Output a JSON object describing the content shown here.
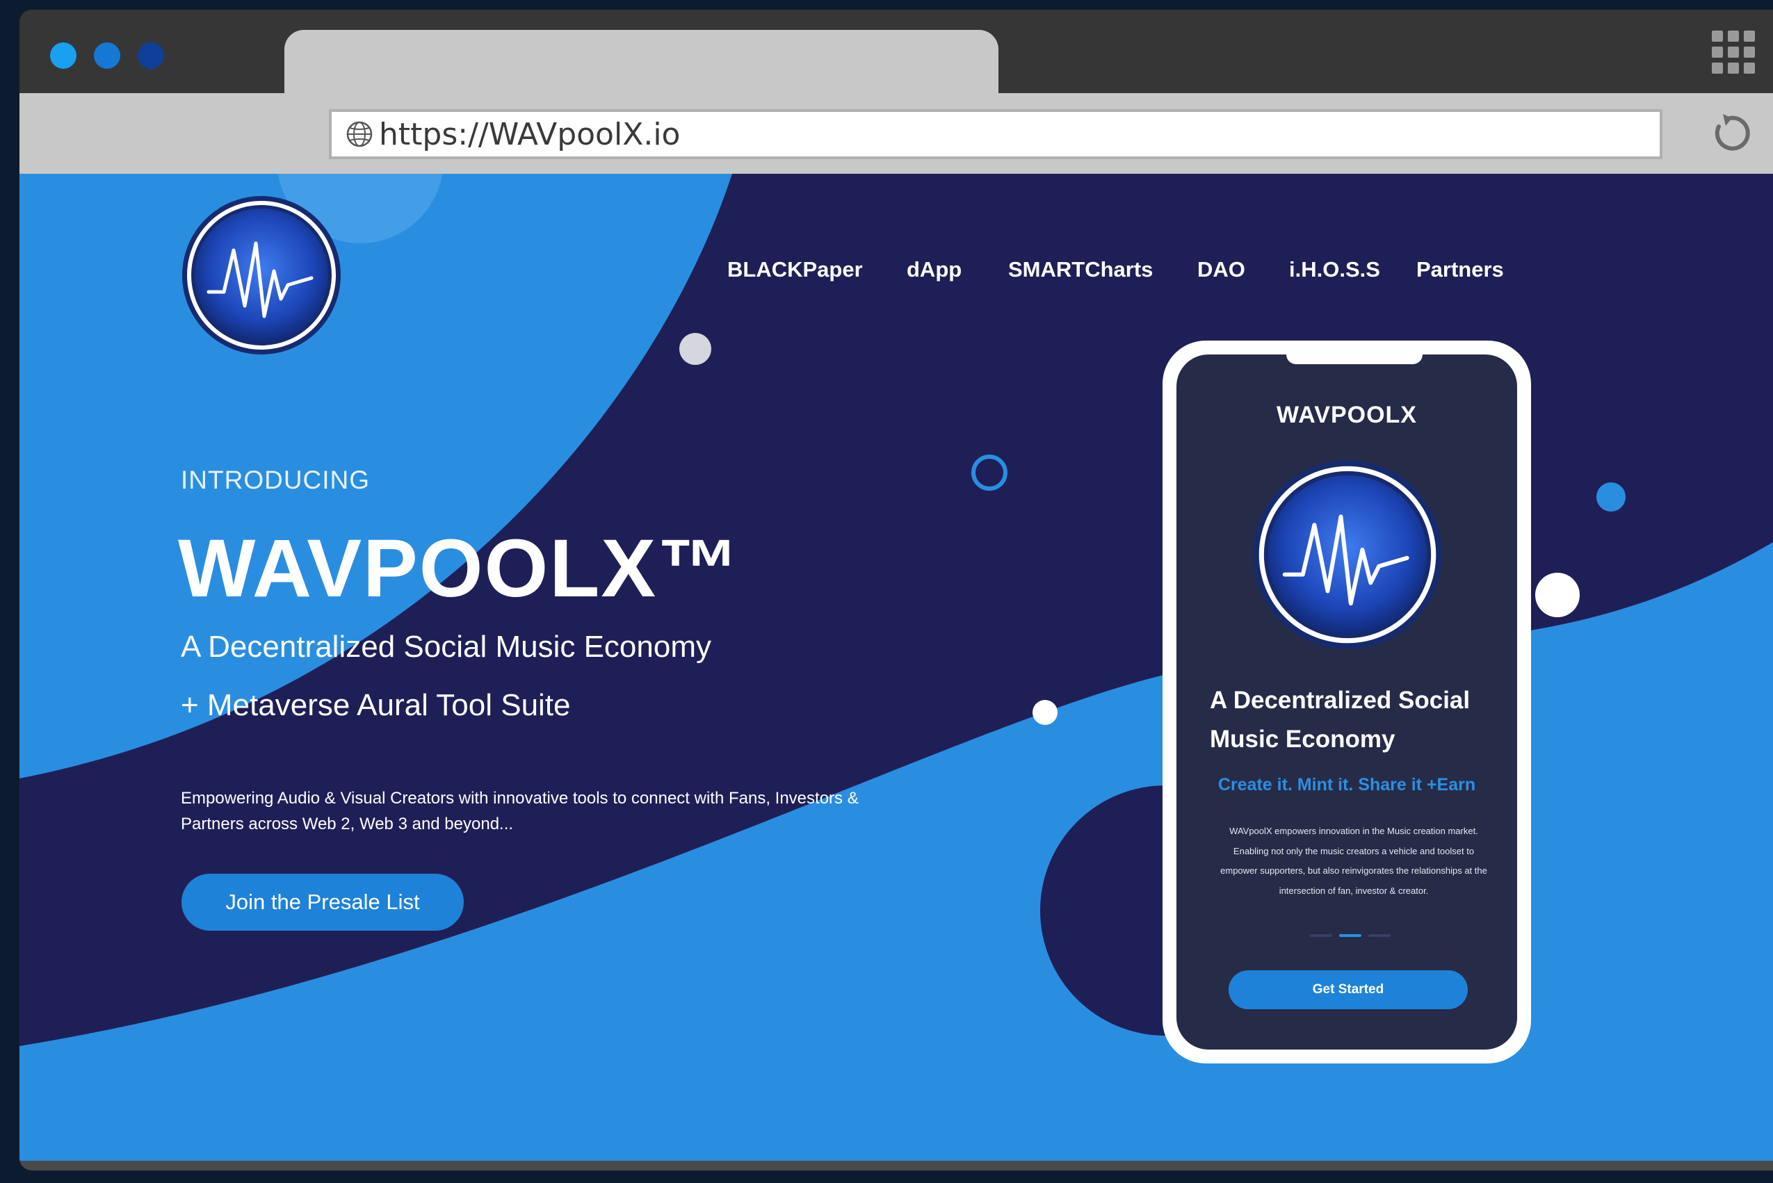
{
  "browser": {
    "url": "https://WAVpoolX.io",
    "traffic_light_colors": [
      "#1aa0f0",
      "#1478d4",
      "#0f3f9a"
    ]
  },
  "site": {
    "nav": [
      "BLACKPaper",
      "dApp",
      "SMARTCharts",
      "DAO",
      "i.H.O.S.S",
      "Partners"
    ],
    "hero": {
      "intro": "INTRODUCING",
      "brand": "WAVPOOLX™",
      "tagline_1": "A Decentralized Social Music Economy",
      "tagline_2": "+ Metaverse Aural Tool Suite",
      "description": "Empowering Audio & Visual Creators with innovative tools to connect with Fans, Investors & Partners across Web 2, Web 3 and beyond...",
      "cta": "Join the Presale List"
    },
    "phone": {
      "brand": "WAVPOOLX",
      "title": "A Decentralized Social Music Economy",
      "subtitle": "Create it. Mint it. Share it +Earn",
      "body": "WAVpoolX empowers innovation in the Music creation market. Enabling not only the music creators a vehicle and toolset to empower supporters, but also reinvigorates the relationships at the intersection of fan, investor & creator.",
      "button": "Get Started"
    },
    "colors": {
      "navy": "#1f1f57",
      "blue": "#2a8ee0",
      "accent_button": "#1e82d8",
      "phone_screen": "#262b48"
    }
  }
}
